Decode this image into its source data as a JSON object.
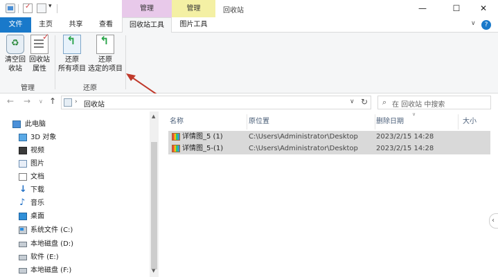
{
  "titlebar": {
    "context_tab_manage": "管理",
    "context_tab_pic": "管理",
    "title": "回收站",
    "minimize": "—",
    "maximize": "☐",
    "close": "✕"
  },
  "menu_tabs": [
    "文件",
    "主页",
    "共享",
    "查看",
    "回收站工具",
    "图片工具"
  ],
  "ribbon": {
    "buttons": [
      {
        "line1": "清空回",
        "line2": "收站",
        "icon": "empty-recycle-bin-icon"
      },
      {
        "line1": "回收站",
        "line2": "属性",
        "icon": "recycle-bin-properties-icon"
      },
      {
        "line1": "还原",
        "line2": "所有项目",
        "icon": "restore-all-icon"
      },
      {
        "line1": "还原",
        "line2": "选定的项目",
        "icon": "restore-selected-icon"
      }
    ],
    "groups": [
      "管理",
      "还原"
    ],
    "annotation_color": "#c0392b"
  },
  "address": {
    "path": "回收站",
    "search_placeholder": "在 回收站 中搜索"
  },
  "nav_tree": {
    "root": "此电脑",
    "items": [
      {
        "label": "3D 对象",
        "icon": "3d-objects-icon"
      },
      {
        "label": "视频",
        "icon": "video-icon"
      },
      {
        "label": "图片",
        "icon": "pictures-icon"
      },
      {
        "label": "文档",
        "icon": "documents-icon"
      },
      {
        "label": "下载",
        "icon": "downloads-icon"
      },
      {
        "label": "音乐",
        "icon": "music-icon"
      },
      {
        "label": "桌面",
        "icon": "desktop-icon"
      },
      {
        "label": "系统文件 (C:)",
        "icon": "system-drive-icon"
      },
      {
        "label": "本地磁盘 (D:)",
        "icon": "drive-icon"
      },
      {
        "label": "软件 (E:)",
        "icon": "drive-icon"
      },
      {
        "label": "本地磁盘 (F:)",
        "icon": "drive-icon"
      }
    ]
  },
  "file_list": {
    "columns": [
      "名称",
      "原位置",
      "删除日期",
      "大小"
    ],
    "rows": [
      {
        "name": "详情图_5 (1)",
        "location": "C:\\Users\\Administrator\\Desktop",
        "deleted": "2023/2/15 14:28"
      },
      {
        "name": "详情图_5-(1)",
        "location": "C:\\Users\\Administrator\\Desktop",
        "deleted": "2023/2/15 14:28"
      }
    ]
  },
  "colors": {
    "file_tab": "#1979ca",
    "manage_context": "#e8c9ea",
    "picture_context": "#f4f0a4",
    "selection": "#d9d9d9"
  }
}
